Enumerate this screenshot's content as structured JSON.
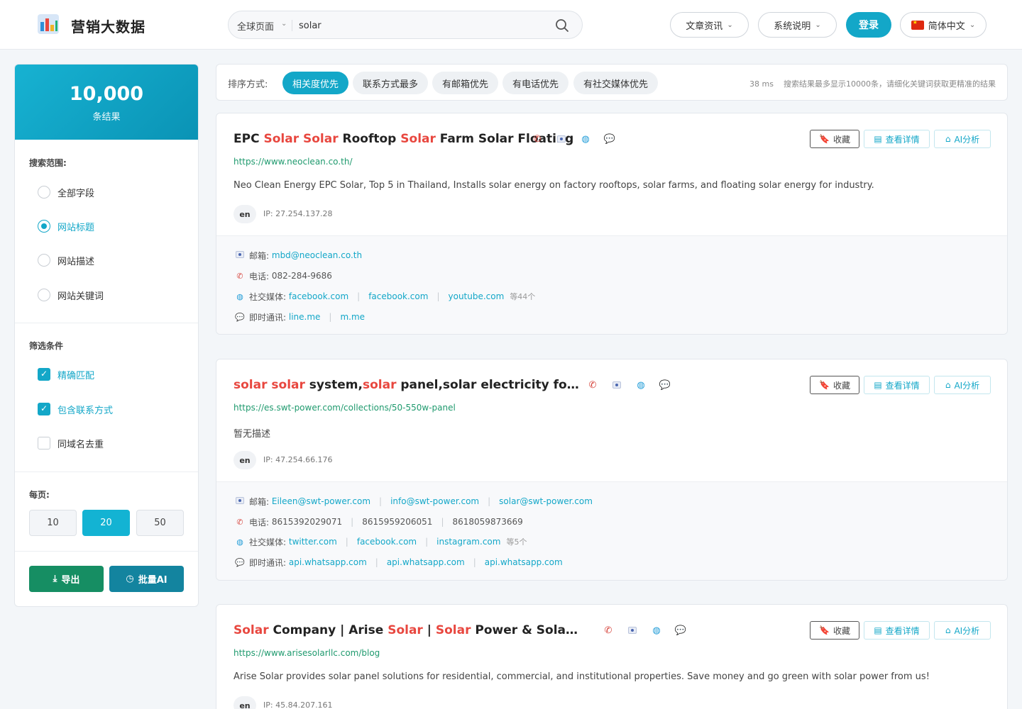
{
  "header": {
    "brand": "营销大数据",
    "search_scope": "全球页面",
    "search_query": "solar",
    "nav_articles": "文章资讯",
    "nav_system": "系统说明",
    "login": "登录",
    "language": "简体中文"
  },
  "sidebar": {
    "result_count": "10,000",
    "result_label": "条结果",
    "scope_title": "搜索范围:",
    "scope_options": [
      "全部字段",
      "网站标题",
      "网站描述",
      "网站关键词"
    ],
    "filter_title": "筛选条件",
    "filters": [
      "精确匹配",
      "包含联系方式",
      "同域名去重"
    ],
    "per_page_title": "每页:",
    "per_page_options": [
      "10",
      "20",
      "50"
    ],
    "export": "导出",
    "batch_ai": "批量AI"
  },
  "sortbar": {
    "label": "排序方式:",
    "options": [
      "相关度优先",
      "联系方式最多",
      "有邮箱优先",
      "有电话优先",
      "有社交媒体优先"
    ],
    "time": "38 ms",
    "note": "搜索结果最多显示10000条，请细化关键词获取更精准的结果"
  },
  "card_buttons": {
    "fav": "收藏",
    "detail": "查看详情",
    "ai": "AI分析"
  },
  "field_labels": {
    "email": "邮箱:",
    "phone": "电话:",
    "social": "社交媒体:",
    "im": "即时通讯:"
  },
  "results": [
    {
      "title": [
        [
          "EPC ",
          0
        ],
        [
          "Solar",
          1
        ],
        [
          " ",
          0
        ],
        [
          "Solar",
          1
        ],
        [
          " Rooftop ",
          0
        ],
        [
          "Solar",
          1
        ],
        [
          " Farm Solar Floating",
          0
        ]
      ],
      "url": "https://www.neoclean.co.th/",
      "desc": "Neo Clean Energy EPC Solar, Top 5 in Thailand, Installs solar energy on factory rooftops, solar farms, and floating solar energy for industry.",
      "lang": "en",
      "ip": "IP: 27.254.137.28",
      "emails": [
        "mbd@neoclean.co.th"
      ],
      "phones": [
        "082-284-9686"
      ],
      "social": [
        "facebook.com",
        "facebook.com",
        "youtube.com"
      ],
      "social_more": "等44个",
      "im": [
        "line.me",
        "m.me"
      ]
    },
    {
      "title": [
        [
          "solar",
          1
        ],
        [
          " ",
          0
        ],
        [
          "solar",
          1
        ],
        [
          " system,",
          0
        ],
        [
          "solar",
          1
        ],
        [
          " panel,solar electricity for home,so...",
          0
        ]
      ],
      "url": "https://es.swt-power.com/collections/50-550w-panel",
      "desc": "暂无描述",
      "lang": "en",
      "ip": "IP: 47.254.66.176",
      "emails": [
        "Eileen@swt-power.com",
        "info@swt-power.com",
        "solar@swt-power.com"
      ],
      "phones": [
        "8615392029071",
        "8615959206051",
        "8618059873669"
      ],
      "social": [
        "twitter.com",
        "facebook.com",
        "instagram.com"
      ],
      "social_more": "等5个",
      "im": [
        "api.whatsapp.com",
        "api.whatsapp.com",
        "api.whatsapp.com"
      ]
    },
    {
      "title": [
        [
          "Solar",
          1
        ],
        [
          " Company | Arise ",
          0
        ],
        [
          "Solar",
          1
        ],
        [
          " | ",
          0
        ],
        [
          "Solar",
          1
        ],
        [
          " Power & Solar Panel Solu...",
          0
        ]
      ],
      "url": "https://www.arisesolarllc.com/blog",
      "desc": "Arise Solar provides solar panel solutions for residential, commercial, and institutional properties. Save money and go green with solar power from us!",
      "lang": "en",
      "ip": "IP: 45.84.207.161"
    }
  ]
}
